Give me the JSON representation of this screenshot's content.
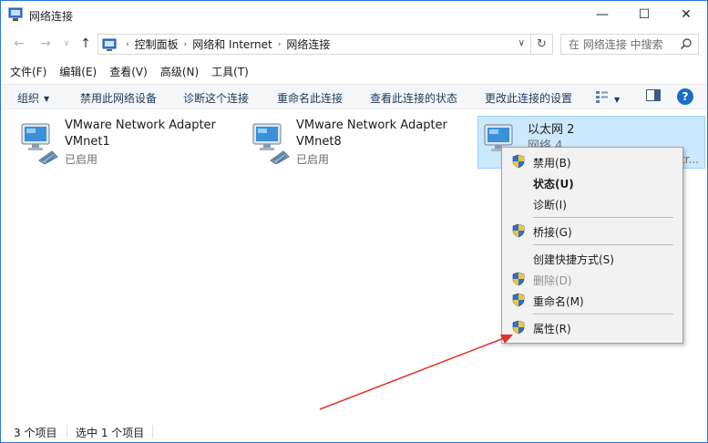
{
  "window": {
    "title": "网络连接",
    "buttons": {
      "minimize": "—",
      "maximize": "☐",
      "close": "✕"
    }
  },
  "nav": {
    "back": "←",
    "forward": "→",
    "recent": "∨",
    "up": "↑",
    "breadcrumb": [
      "控制面板",
      "网络和 Internet",
      "网络连接"
    ],
    "breadcrumb_sep": "›",
    "dropdown": "∨",
    "refresh": "↻",
    "search_placeholder": "在 网络连接 中搜索"
  },
  "menubar": [
    "文件(F)",
    "编辑(E)",
    "查看(V)",
    "高级(N)",
    "工具(T)"
  ],
  "commandbar": {
    "organize": "组织",
    "disable_device": "禁用此网络设备",
    "diagnose": "诊断这个连接",
    "rename": "重命名此连接",
    "view_status": "查看此连接的状态",
    "change_settings": "更改此连接的设置",
    "help": "?"
  },
  "adapters": [
    {
      "name": "VMware Network Adapter",
      "sub": "VMnet1",
      "status": "已启用",
      "extra": ""
    },
    {
      "name": "VMware Network Adapter",
      "sub": "VMnet8",
      "status": "已启用",
      "extra": ""
    },
    {
      "name": "以太网 2",
      "sub": "网络 4",
      "status": "",
      "extra": "tr..."
    }
  ],
  "context_menu": [
    {
      "label": "禁用(B)",
      "shield": true,
      "bold": false,
      "disabled": false
    },
    {
      "label": "状态(U)",
      "shield": false,
      "bold": true,
      "disabled": false
    },
    {
      "label": "诊断(I)",
      "shield": false,
      "bold": false,
      "disabled": false
    },
    {
      "label": "桥接(G)",
      "shield": true,
      "bold": false,
      "disabled": false
    },
    {
      "label": "创建快捷方式(S)",
      "shield": false,
      "bold": false,
      "disabled": false
    },
    {
      "label": "删除(D)",
      "shield": true,
      "bold": false,
      "disabled": true
    },
    {
      "label": "重命名(M)",
      "shield": true,
      "bold": false,
      "disabled": false
    },
    {
      "label": "属性(R)",
      "shield": true,
      "bold": false,
      "disabled": false
    }
  ],
  "statusbar": {
    "count": "3 个项目",
    "selected": "选中 1 个项目"
  },
  "colors": {
    "accent": "#2b78d4",
    "selection": "#cce8ff",
    "selection_border": "#99d1ff",
    "command_text": "#1e395b",
    "annotation_arrow": "#e0322a"
  },
  "icons": {
    "app": "network-connections-icon",
    "adapter": "network-adapter-icon",
    "shield": "uac-shield-icon",
    "search": "search-icon",
    "help": "help-icon"
  }
}
